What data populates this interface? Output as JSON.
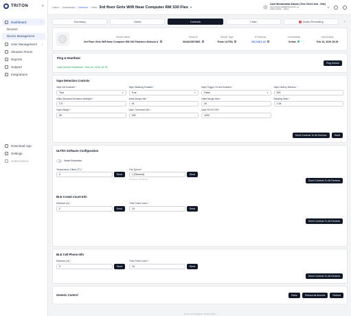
{
  "app": {
    "logo_text": "TRITON",
    "collapse_glyph": "«"
  },
  "sidebar": {
    "dashboard": "Dashboard",
    "devices": "Devices",
    "device_management": "Device Management",
    "user_management": "User Management",
    "situation_room": "Situation Room",
    "reports": "Reports",
    "support": "Support",
    "integrations": "Integrations",
    "download_app": "Download App",
    "settings": "Settings",
    "subscription": "Subscription"
  },
  "topbar": {
    "crumb_client": "Client",
    "crumb_dashboard": "Dashboard",
    "crumb_devices": "Devices",
    "crumb_view": "View:",
    "view_value": "3rd floor Girls W/R Near Computer RM 330 Flex",
    "user_name": "Amir Mohammad Absum (Test Client test - Site)",
    "user_email": "amirmohammad@trtnsensor.us",
    "user_role": "Admin Mode · Client"
  },
  "tabs": {
    "summary": "Summary",
    "alerts": "Alerts",
    "controls": "Controls",
    "chart": "Chart",
    "audio_recording": "Audio Recording"
  },
  "device": {
    "name_label": "Device Name",
    "name_value": "3rd Floor Girls W/R Near Computer RM 330 Flatshers Motseio A",
    "serial_label": "Serial ID",
    "serial_value": "3043A3D0788S",
    "type_label": "Device Type",
    "type_value": "Triton ULTRA",
    "ip_label": "IP Address",
    "ip_value": "192.168.1.22",
    "connectivity_label": "Connectivity",
    "connectivity_value": "Online",
    "last_activity_label": "Last Activity",
    "last_activity_value": "Feb 16, 2026 15:39"
  },
  "ping": {
    "title": "Ping & Heartbeat",
    "heartbeat": "Last Device Heartbeat : Feb 16, 2026 15:39",
    "button": "Ping Device"
  },
  "vape": {
    "title": "Vape Detection Controls",
    "fields": [
      {
        "label": "Vape Init Enabled",
        "value": "True",
        "select": true
      },
      {
        "label": "Vape Masking Enabled",
        "value": "True",
        "select": true
      },
      {
        "label": "Vape Trigger On Init Enabled",
        "value": "False",
        "select": true
      },
      {
        "label": "Vape History Window",
        "value": "300",
        "select": false
      },
      {
        "label": "Initial Standard Deviation Multiplier",
        "value": "2.5",
        "select": false
      },
      {
        "label": "Initial Margin Min",
        "value": "15",
        "select": false
      },
      {
        "label": "Initial Margin Max",
        "value": "25",
        "select": false
      },
      {
        "label": "Masking Ratio",
        "value": "1.54",
        "select": false
      },
      {
        "label": "Vape Margin",
        "value": "50",
        "select": false
      },
      {
        "label": "Vape Threshold Min",
        "value": "150",
        "select": false
      },
      {
        "label": "Vape RCHO Diff",
        "value": "1000",
        "select": false
      }
    ],
    "send_all": "Send Controls To All Devices",
    "send": "Send"
  },
  "ultra": {
    "title": "ULTRA Software Configuration",
    "noise_reduction": "Noise Reduction",
    "temp_label": "Temperature Offset (°F)",
    "temp_value": "0",
    "fan_label": "Fan Speed",
    "fan_value": "1 (Slowest)",
    "fan_hint": "1=slowest, 10=fastest",
    "send": "Send",
    "send_all": "Send Controls To All Devices"
  },
  "ble_crowd": {
    "title": "BLE Crowd Count Info",
    "distance_label": "Distance (m)",
    "distance_value": "2",
    "timeframe_label": "Time Frame (sec)",
    "timeframe_value": "10",
    "send": "Send",
    "send_all": "Send Controls To All Devices"
  },
  "ble_cell": {
    "title": "BLE Cell Phone Info",
    "distance_label": "Distance (m)",
    "distance_value": "3",
    "timeframe_label": "Time Frame (sec)",
    "timeframe_value": "10",
    "send": "Send",
    "send_all": "Send Controls To All Devices"
  },
  "generic": {
    "title": "Generic Control",
    "panic": "Panic",
    "reboot_all": "Reboot all devices",
    "reboot": "Reboot"
  },
  "footer": "Terms and Conditions | Privacy Policy",
  "colors": {
    "accent": "#1e3a8a",
    "online": "#22c55e",
    "heartbeat": "#16a34a",
    "link": "#2563eb",
    "record": "#ef4444"
  }
}
